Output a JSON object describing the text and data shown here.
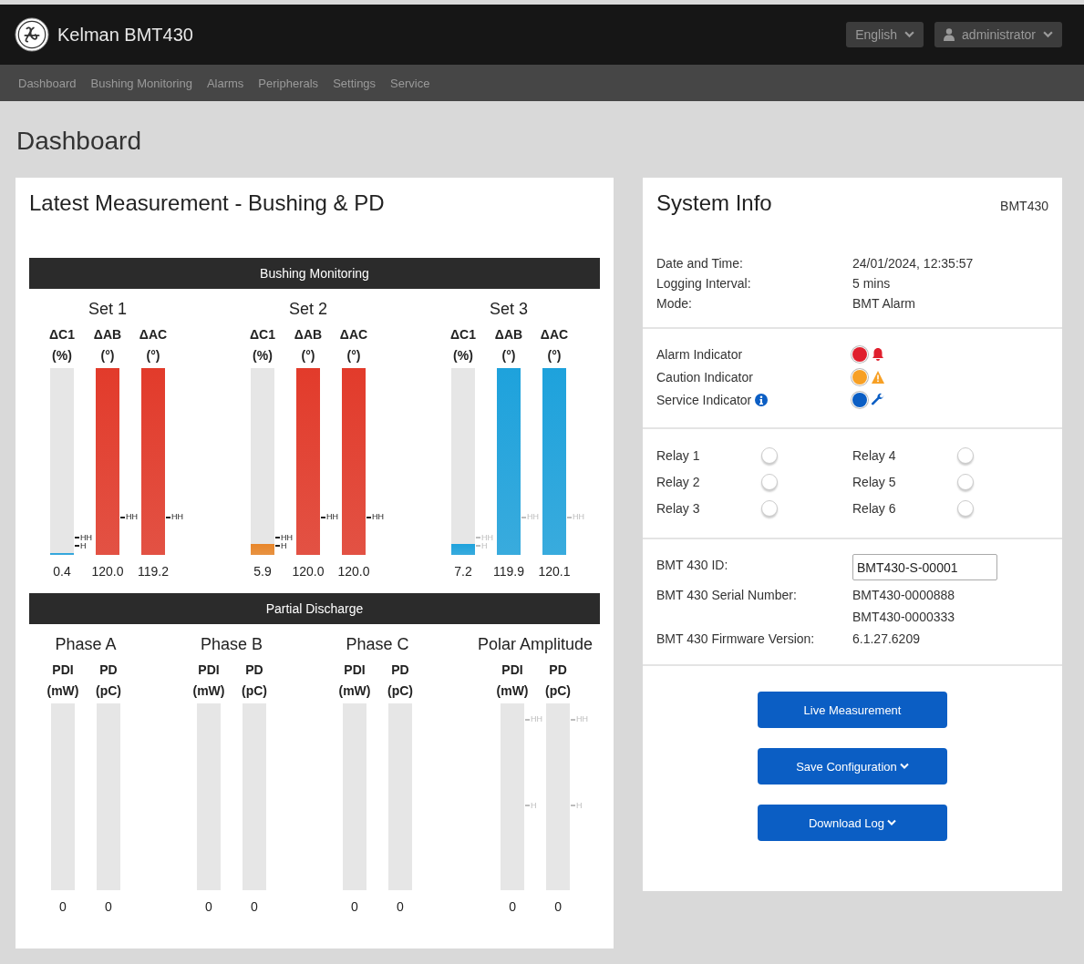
{
  "header": {
    "brand": "Kelman BMT430",
    "language": "English",
    "user": "administrator"
  },
  "nav": [
    {
      "label": "Dashboard"
    },
    {
      "label": "Bushing Monitoring"
    },
    {
      "label": "Alarms"
    },
    {
      "label": "Peripherals"
    },
    {
      "label": "Settings"
    },
    {
      "label": "Service"
    }
  ],
  "page_title": "Dashboard",
  "measurement": {
    "title": "Latest Measurement - Bushing & PD",
    "sections": [
      {
        "title": "Bushing Monitoring",
        "groups": [
          {
            "title": "Set 1",
            "bars": [
              {
                "kind": "c1",
                "name": "ΔC1",
                "unit": "(%)",
                "level": 0.01,
                "color": "#29a3dc",
                "value": "0.4",
                "markers": [
                  {
                    "label": "HH",
                    "active": true
                  },
                  {
                    "label": "H",
                    "active": true
                  }
                ]
              },
              {
                "kind": "angle",
                "name": "ΔAB",
                "unit": "(°)",
                "level": 1,
                "color": "#e23b2b",
                "value": "120.0",
                "markers": [
                  {
                    "label": "HH",
                    "active": true
                  }
                ]
              },
              {
                "kind": "angle",
                "name": "ΔAC",
                "unit": "(°)",
                "level": 1,
                "color": "#e23b2b",
                "value": "119.2",
                "markers": [
                  {
                    "label": "HH",
                    "active": true
                  }
                ]
              }
            ]
          },
          {
            "title": "Set 2",
            "bars": [
              {
                "kind": "c1",
                "name": "ΔC1",
                "unit": "(%)",
                "level": 0.06,
                "color": "#e8862a",
                "value": "5.9",
                "markers": [
                  {
                    "label": "HH",
                    "active": true
                  },
                  {
                    "label": "H",
                    "active": true
                  }
                ]
              },
              {
                "kind": "angle",
                "name": "ΔAB",
                "unit": "(°)",
                "level": 1,
                "color": "#e23b2b",
                "value": "120.0",
                "markers": [
                  {
                    "label": "HH",
                    "active": true
                  }
                ]
              },
              {
                "kind": "angle",
                "name": "ΔAC",
                "unit": "(°)",
                "level": 1,
                "color": "#e23b2b",
                "value": "120.0",
                "markers": [
                  {
                    "label": "HH",
                    "active": true
                  }
                ]
              }
            ]
          },
          {
            "title": "Set 3",
            "bars": [
              {
                "kind": "c1",
                "name": "ΔC1",
                "unit": "(%)",
                "level": 0.06,
                "color": "#1ea2dc",
                "value": "7.2",
                "markers": [
                  {
                    "label": "HH",
                    "active": false
                  },
                  {
                    "label": "H",
                    "active": false
                  }
                ]
              },
              {
                "kind": "angle",
                "name": "ΔAB",
                "unit": "(°)",
                "level": 1,
                "color": "#1ea2dc",
                "value": "119.9",
                "markers": [
                  {
                    "label": "HH",
                    "active": false
                  }
                ]
              },
              {
                "kind": "angle",
                "name": "ΔAC",
                "unit": "(°)",
                "level": 1,
                "color": "#1ea2dc",
                "value": "120.1",
                "markers": [
                  {
                    "label": "HH",
                    "active": false
                  }
                ]
              }
            ]
          }
        ]
      },
      {
        "title": "Partial Discharge",
        "groups": [
          {
            "title": "Phase A",
            "bars": [
              {
                "kind": "pd",
                "name": "PDI",
                "unit": "(mW)",
                "value": "0"
              },
              {
                "kind": "pd",
                "name": "PD",
                "unit": "(pC)",
                "value": "0"
              }
            ]
          },
          {
            "title": "Phase B",
            "bars": [
              {
                "kind": "pd",
                "name": "PDI",
                "unit": "(mW)",
                "value": "0"
              },
              {
                "kind": "pd",
                "name": "PD",
                "unit": "(pC)",
                "value": "0"
              }
            ]
          },
          {
            "title": "Phase C",
            "bars": [
              {
                "kind": "pd",
                "name": "PDI",
                "unit": "(mW)",
                "value": "0"
              },
              {
                "kind": "pd",
                "name": "PD",
                "unit": "(pC)",
                "value": "0"
              }
            ]
          },
          {
            "title": "Polar Amplitude",
            "bars": [
              {
                "kind": "polar",
                "name": "PDI",
                "unit": "(mW)",
                "value": "0",
                "markers": [
                  {
                    "label": "HH",
                    "active": false
                  },
                  {
                    "label": "H",
                    "active": false
                  }
                ]
              },
              {
                "kind": "polar",
                "name": "PD",
                "unit": "(pC)",
                "value": "0",
                "markers": [
                  {
                    "label": "HH",
                    "active": false
                  },
                  {
                    "label": "H",
                    "active": false
                  }
                ]
              }
            ]
          }
        ]
      }
    ]
  },
  "system_info": {
    "title": "System Info",
    "model": "BMT430",
    "details": [
      {
        "label": "Date and Time:",
        "value": "24/01/2024, 12:35:57"
      },
      {
        "label": "Logging Interval:",
        "value": "5 mins"
      },
      {
        "label": "Mode:",
        "value": "BMT Alarm"
      }
    ],
    "indicators": [
      {
        "label": "Alarm Indicator",
        "color": "#e0202e",
        "kind": "alarm",
        "info": false
      },
      {
        "label": "Caution Indicator",
        "color": "#f7a025",
        "kind": "caution",
        "info": false
      },
      {
        "label": "Service Indicator",
        "color": "#0b5ec4",
        "kind": "service",
        "info": true
      }
    ],
    "relays": [
      {
        "label": "Relay 1",
        "on": false
      },
      {
        "label": "Relay 2",
        "on": false
      },
      {
        "label": "Relay 3",
        "on": false
      },
      {
        "label": "Relay 4",
        "on": false
      },
      {
        "label": "Relay 5",
        "on": false
      },
      {
        "label": "Relay 6",
        "on": false
      }
    ],
    "device": [
      {
        "kind": "input",
        "label": "BMT 430 ID:",
        "values": [
          "BMT430-S-00001"
        ]
      },
      {
        "kind": "text",
        "label": "BMT 430 Serial Number:",
        "values": [
          "BMT430-0000888",
          "BMT430-0000333"
        ]
      },
      {
        "kind": "text",
        "label": "BMT 430 Firmware Version:",
        "values": [
          "6.1.27.6209"
        ]
      }
    ],
    "buttons": [
      {
        "label": "Live Measurement",
        "dropdown": false
      },
      {
        "label": "Save Configuration",
        "dropdown": true
      },
      {
        "label": "Download Log",
        "dropdown": true
      }
    ]
  }
}
